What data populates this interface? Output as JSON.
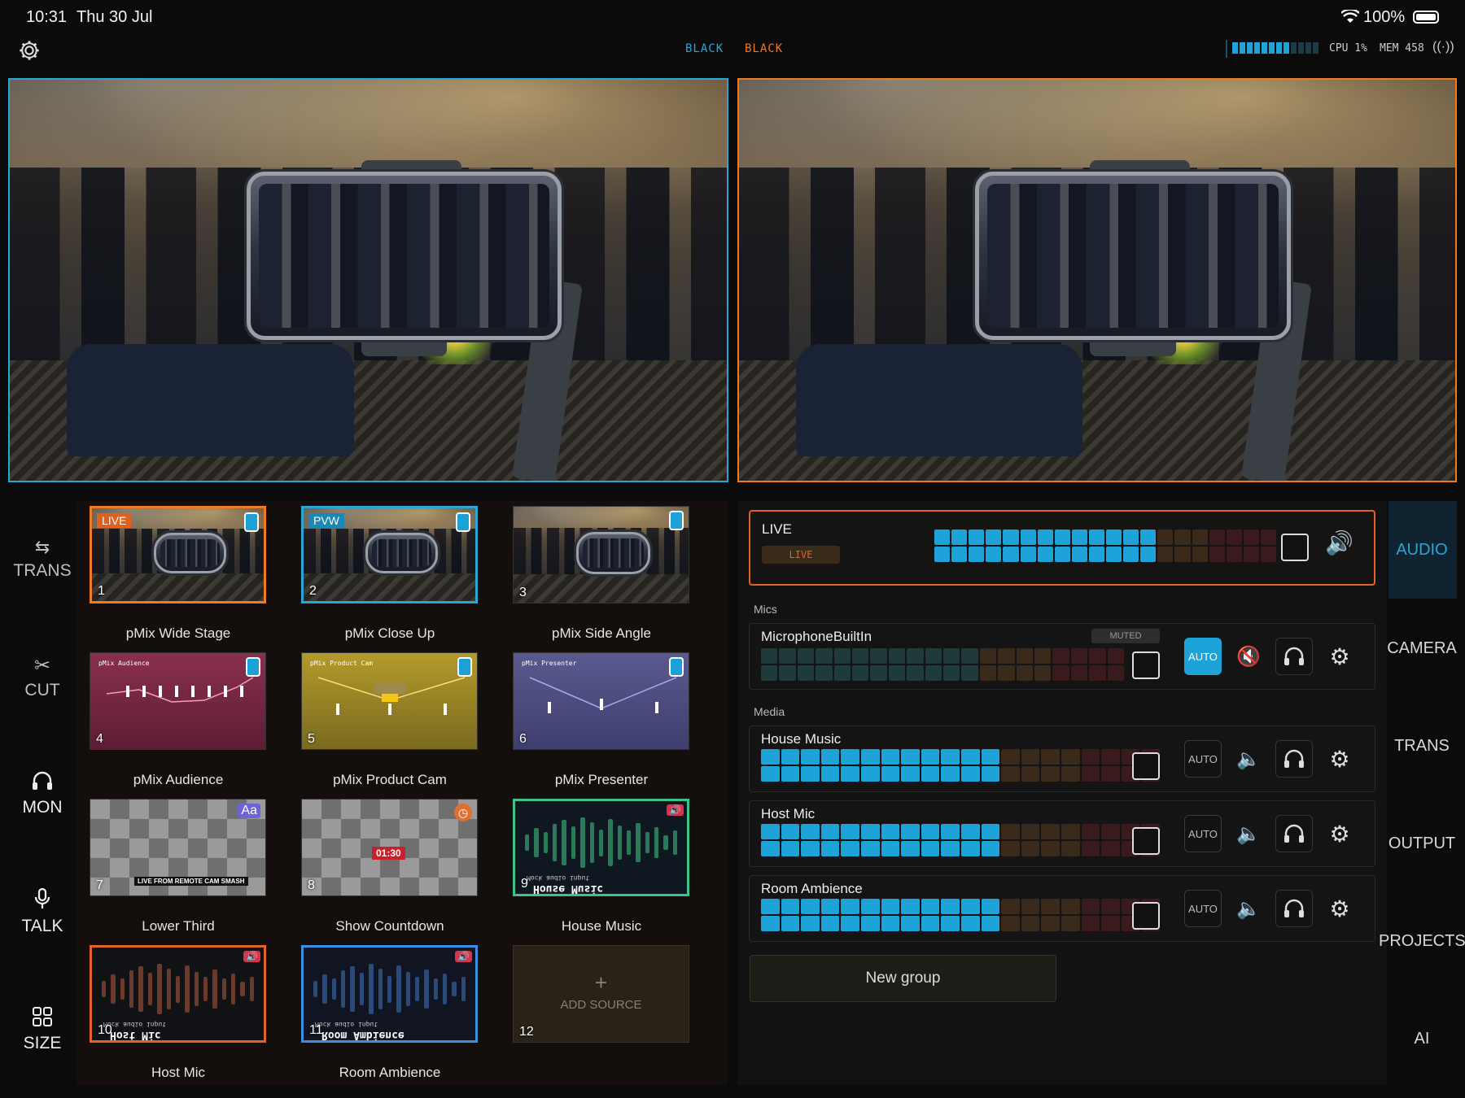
{
  "status_bar": {
    "time": "10:31",
    "date": "Thu 30 Jul",
    "battery": "100%"
  },
  "top_bar": {
    "program_label": "BLACK",
    "preview_label": "BLACK",
    "cpu": "CPU 1%",
    "mem": "MEM 458",
    "accent_program": "#2aa6d6",
    "accent_preview": "#f07a22"
  },
  "left_nav": [
    {
      "label": "TRANS",
      "icon": "arrows-swap-icon"
    },
    {
      "label": "CUT",
      "icon": "scissors-icon"
    },
    {
      "label": "MON",
      "icon": "headphones-icon"
    },
    {
      "label": "TALK",
      "icon": "microphone-icon"
    },
    {
      "label": "SIZE",
      "icon": "grid-icon"
    }
  ],
  "sources": [
    {
      "num": "1",
      "name": "pMix Wide Stage",
      "badge": "LIVE"
    },
    {
      "num": "2",
      "name": "pMix Close Up",
      "badge": "PVW"
    },
    {
      "num": "3",
      "name": "pMix Side Angle"
    },
    {
      "num": "4",
      "name": "pMix Audience",
      "thumb_title": "pMix Audience"
    },
    {
      "num": "5",
      "name": "pMix Product Cam",
      "thumb_title": "pMix Product Cam"
    },
    {
      "num": "6",
      "name": "pMix Presenter",
      "thumb_title": "pMix Presenter"
    },
    {
      "num": "7",
      "name": "Lower Third",
      "overlay_text": "LIVE FROM REMOTE CAM SMASH",
      "icon_text": "Aa"
    },
    {
      "num": "8",
      "name": "Show Countdown",
      "overlay_text": "01:30"
    },
    {
      "num": "9",
      "name": "House Music",
      "wave_text": "House Music",
      "wave_sub": "Mock audio input"
    },
    {
      "num": "10",
      "name": "Host Mic",
      "wave_text": "Host Mic",
      "wave_sub": "Mock audio input"
    },
    {
      "num": "11",
      "name": "Room Ambience",
      "wave_text": "Room Ambience",
      "wave_sub": "Mock audio input"
    },
    {
      "num": "12",
      "name": "",
      "add_label": "ADD SOURCE"
    }
  ],
  "audio": {
    "master": {
      "name": "LIVE",
      "tag": "LIVE",
      "level": 0.65
    },
    "mics_label": "Mics",
    "mics": [
      {
        "name": "MicrophoneBuiltIn",
        "muted_label": "MUTED",
        "auto": "AUTO",
        "level": 0
      }
    ],
    "media_label": "Media",
    "media": [
      {
        "name": "House Music",
        "auto": "AUTO",
        "level": 0.6
      },
      {
        "name": "Host Mic",
        "auto": "AUTO",
        "level": 0.6
      },
      {
        "name": "Room Ambience",
        "auto": "AUTO",
        "level": 0.6
      }
    ],
    "new_group": "New group"
  },
  "right_nav": [
    "AUDIO",
    "CAMERA",
    "TRANS",
    "OUTPUT",
    "PROJECTS",
    "AI"
  ]
}
